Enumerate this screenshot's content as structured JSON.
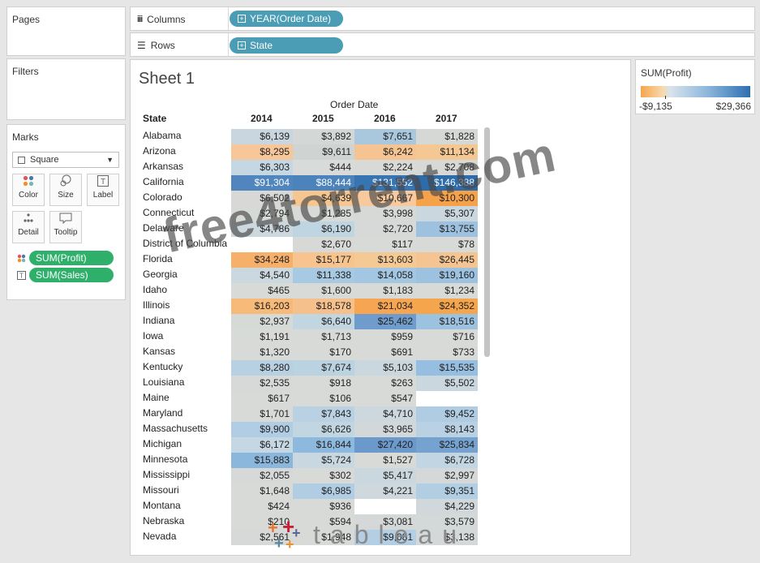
{
  "pages": {
    "title": "Pages"
  },
  "columns": {
    "label": "Columns",
    "pill": "YEAR(Order Date)"
  },
  "rows": {
    "label": "Rows",
    "pill": "State"
  },
  "filters": {
    "title": "Filters"
  },
  "marks": {
    "title": "Marks",
    "mark_type": "Square",
    "buttons": {
      "color": "Color",
      "size": "Size",
      "label": "Label",
      "detail": "Detail",
      "tooltip": "Tooltip"
    },
    "pills": {
      "profit": "SUM(Profit)",
      "sales": "SUM(Sales)"
    }
  },
  "sheet": {
    "title": "Sheet 1",
    "column_caption": "Order Date",
    "row_header": "State"
  },
  "legend": {
    "title": "SUM(Profit)",
    "min": "-$9,135",
    "max": "$29,366"
  },
  "watermark": "free4torrent.com",
  "logo": {
    "word": "tableau"
  },
  "colors": {
    "orange": "#f5a54b",
    "blue": "#2e6fb1",
    "pill_blue": "#4a9db4",
    "pill_green": "#2fb06a"
  },
  "table": {
    "years": [
      "2014",
      "2015",
      "2016",
      "2017"
    ],
    "rows": [
      {
        "state": "Alabama",
        "values": [
          "$6,139",
          "$3,892",
          "$7,651",
          "$1,828"
        ],
        "colors": [
          "#c9d6df",
          "#d3d7d5",
          "#a9c7dd",
          "#d6d8d6"
        ]
      },
      {
        "state": "Arizona",
        "values": [
          "$8,295",
          "$9,611",
          "$6,242",
          "$11,134"
        ],
        "colors": [
          "#f7c79a",
          "#cfd3d2",
          "#f6c492",
          "#f5c793"
        ]
      },
      {
        "state": "Arkansas",
        "values": [
          "$6,303",
          "$444",
          "$2,224",
          "$2,708"
        ],
        "colors": [
          "#c5d7e3",
          "#d8dbd9",
          "#d8dad7",
          "#d6d9d6"
        ]
      },
      {
        "state": "California",
        "values": [
          "$91,304",
          "$88,444",
          "$131,552",
          "$146,388"
        ],
        "colors": [
          "#5086bd",
          "#4c83bb",
          "#3774b2",
          "#2e6ba9"
        ]
      },
      {
        "state": "Colorado",
        "values": [
          "$6,502",
          "$4,639",
          "$10,667",
          "$10,300"
        ],
        "colors": [
          "#d8d8d6",
          "#f5c690",
          "#f7c99d",
          "#f6a24a"
        ]
      },
      {
        "state": "Connecticut",
        "values": [
          "$2,794",
          "$1,285",
          "$3,998",
          "$5,307"
        ],
        "colors": [
          "#d6dad7",
          "#d8dad8",
          "#d6d9d6",
          "#cbd7df"
        ]
      },
      {
        "state": "Delaware",
        "values": [
          "$4,786",
          "$6,190",
          "$2,720",
          "$13,755"
        ],
        "colors": [
          "#ccd7de",
          "#c0d5e2",
          "#d6d9d7",
          "#9dc1de"
        ]
      },
      {
        "state": "District of Columbia",
        "values": [
          "",
          "$2,670",
          "$117",
          "$78"
        ],
        "colors": [
          "#ffffff",
          "#d6d9d6",
          "#d8dad8",
          "#d8dad8"
        ]
      },
      {
        "state": "Florida",
        "values": [
          "$34,248",
          "$15,177",
          "$13,603",
          "$26,445"
        ],
        "colors": [
          "#f6b06a",
          "#f7c38e",
          "#f5c994",
          "#f4c592"
        ]
      },
      {
        "state": "Georgia",
        "values": [
          "$4,540",
          "$11,338",
          "$14,058",
          "$19,160"
        ],
        "colors": [
          "#ccd8df",
          "#a8c9e2",
          "#a3c7e2",
          "#9cc2e0"
        ]
      },
      {
        "state": "Idaho",
        "values": [
          "$465",
          "$1,600",
          "$1,183",
          "$1,234"
        ],
        "colors": [
          "#d8dad8",
          "#d8dad8",
          "#d8dad8",
          "#d8dad8"
        ]
      },
      {
        "state": "Illinois",
        "values": [
          "$16,203",
          "$18,578",
          "$21,034",
          "$24,352"
        ],
        "colors": [
          "#f7ba78",
          "#f5c08c",
          "#f6a652",
          "#f5a54b"
        ]
      },
      {
        "state": "Indiana",
        "values": [
          "$2,937",
          "$6,640",
          "$25,462",
          "$18,516"
        ],
        "colors": [
          "#d6dad7",
          "#c2d6e2",
          "#6f9ccc",
          "#9dc2e0"
        ]
      },
      {
        "state": "Iowa",
        "values": [
          "$1,191",
          "$1,713",
          "$959",
          "$716"
        ],
        "colors": [
          "#d8dad8",
          "#d8dad8",
          "#d8dad8",
          "#d8dad8"
        ]
      },
      {
        "state": "Kansas",
        "values": [
          "$1,320",
          "$170",
          "$691",
          "$733"
        ],
        "colors": [
          "#d8dad8",
          "#d8dad8",
          "#d8dad8",
          "#d8dad8"
        ]
      },
      {
        "state": "Kentucky",
        "values": [
          "$8,280",
          "$7,674",
          "$5,103",
          "$15,535"
        ],
        "colors": [
          "#b7d0e2",
          "#bbd2e1",
          "#cbd7df",
          "#96bee0"
        ]
      },
      {
        "state": "Louisiana",
        "values": [
          "$2,535",
          "$918",
          "$263",
          "$5,502"
        ],
        "colors": [
          "#d6d9d7",
          "#d8dad8",
          "#d8dad8",
          "#cad7df"
        ]
      },
      {
        "state": "Maine",
        "values": [
          "$617",
          "$106",
          "$547",
          ""
        ],
        "colors": [
          "#d8dad8",
          "#d8dad8",
          "#d8dad8",
          "#ffffff"
        ]
      },
      {
        "state": "Maryland",
        "values": [
          "$1,701",
          "$7,843",
          "$4,710",
          "$9,452"
        ],
        "colors": [
          "#d8dad8",
          "#b9d1e2",
          "#cdd7de",
          "#afcce3"
        ]
      },
      {
        "state": "Massachusetts",
        "values": [
          "$9,900",
          "$6,626",
          "$3,965",
          "$8,143"
        ],
        "colors": [
          "#b1cde3",
          "#c2d6e2",
          "#d2d8da",
          "#b9d1e2"
        ]
      },
      {
        "state": "Michigan",
        "values": [
          "$6,172",
          "$16,844",
          "$27,420",
          "$25,834"
        ],
        "colors": [
          "#c5d7e2",
          "#8eb9de",
          "#6b99cb",
          "#76a2d0"
        ]
      },
      {
        "state": "Minnesota",
        "values": [
          "$15,883",
          "$5,724",
          "$1,527",
          "$6,728"
        ],
        "colors": [
          "#8cb7dd",
          "#c8d7e0",
          "#d8dad8",
          "#c1d5e2"
        ]
      },
      {
        "state": "Mississippi",
        "values": [
          "$2,055",
          "$302",
          "$5,417",
          "$2,997"
        ],
        "colors": [
          "#d6d9d7",
          "#d8dad8",
          "#cad7df",
          "#d4d8d8"
        ]
      },
      {
        "state": "Missouri",
        "values": [
          "$1,648",
          "$6,985",
          "$4,221",
          "$9,351"
        ],
        "colors": [
          "#d8dad8",
          "#b0cde3",
          "#cfd8dc",
          "#b2cee3"
        ]
      },
      {
        "state": "Montana",
        "values": [
          "$424",
          "$936",
          "",
          "$4,229"
        ],
        "colors": [
          "#d8dad8",
          "#d8dad8",
          "#ffffff",
          "#d0d8db"
        ]
      },
      {
        "state": "Nebraska",
        "values": [
          "$210",
          "$594",
          "$3,081",
          "$3,579"
        ],
        "colors": [
          "#d8dad8",
          "#d8dad8",
          "#d4d8d8",
          "#d3d8d9"
        ]
      },
      {
        "state": "Nevada",
        "values": [
          "$2,561",
          "$1,948",
          "$9,081",
          "$3,138"
        ],
        "colors": [
          "#d6d9d7",
          "#d8dad8",
          "#b4cfe3",
          "#d4d8d8"
        ]
      }
    ]
  }
}
